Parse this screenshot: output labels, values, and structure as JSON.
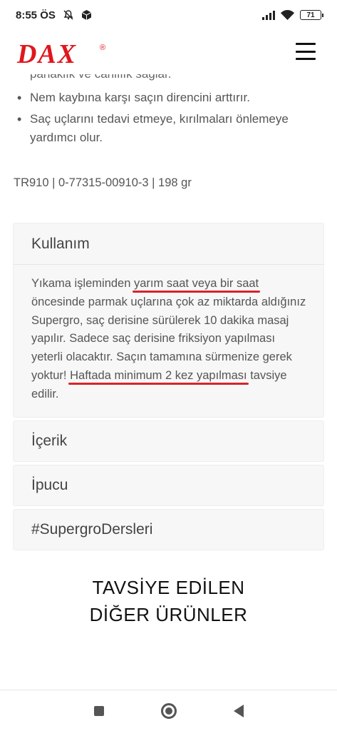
{
  "status_bar": {
    "time": "8:55 ÖS",
    "battery": "71"
  },
  "brand": {
    "name": "DAX",
    "registered": "®",
    "color": "#e1161d"
  },
  "product": {
    "cut_line": "parlaklık ve canlılık sağlar.",
    "bullets": [
      "Nem kaybına karşı saçın direncini arttırır.",
      "Saç uçlarını tedavi etmeye, kırılmaları önlemeye yardımcı olur."
    ],
    "sku": "TR910 | 0-77315-00910-3 | 198 gr"
  },
  "accordion": {
    "usage": {
      "title": "Kullanım",
      "text_1": "Yıkama işleminden ",
      "text_2": "yarım saat veya bir saat",
      "text_3": " öncesinde parmak uçlarına çok az miktarda aldığınız Supergro, saç derisine sürülerek 10 dakika masaj yapılır. Sadece saç derisine friksiyon yapılması yeterli olacaktır. Saçın tamamına sürmenize gerek yoktur! ",
      "text_4": "Haftada minimum 2 kez yapılması",
      "text_5": " tavsiye edilir."
    },
    "items": [
      "İçerik",
      "İpucu",
      "#SupergroDersleri"
    ]
  },
  "recommend": {
    "line_1": "TAVSİYE EDİLEN",
    "line_2": "DİĞER ÜRÜNLER"
  },
  "icons": {
    "signal": "signal-icon",
    "wifi": "wifi-icon",
    "mute": "bell-off-icon",
    "box": "package-icon",
    "menu": "hamburger-icon"
  }
}
